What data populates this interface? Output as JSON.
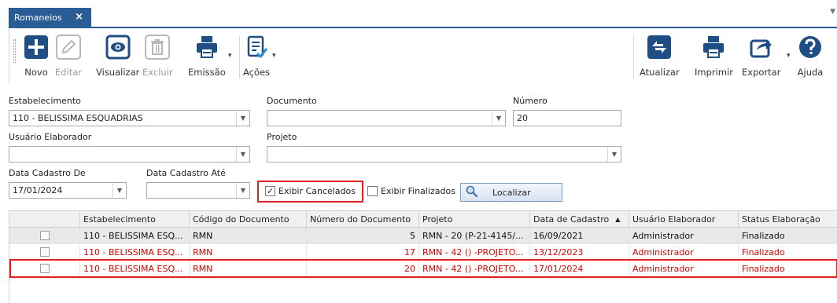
{
  "tab": {
    "label": "Romaneios",
    "close": "×"
  },
  "toolbar": {
    "left": [
      {
        "label": "Novo",
        "icon": "plus-icon",
        "enabled": true
      },
      {
        "label": "Editar",
        "icon": "pencil-icon",
        "enabled": false
      },
      {
        "label": "Visualizar",
        "icon": "eye-icon",
        "enabled": true
      },
      {
        "label": "Excluir",
        "icon": "trash-icon",
        "enabled": false
      },
      {
        "label": "Emissão",
        "icon": "printer-icon",
        "enabled": true
      },
      {
        "label": "Ações",
        "icon": "checklist-icon",
        "enabled": true
      }
    ],
    "right": [
      {
        "label": "Atualizar",
        "icon": "refresh-icon"
      },
      {
        "label": "Imprimir",
        "icon": "printer-icon"
      },
      {
        "label": "Exportar",
        "icon": "export-icon"
      },
      {
        "label": "Ajuda",
        "icon": "help-icon"
      }
    ]
  },
  "filters": {
    "estabelecimento": {
      "label": "Estabelecimento",
      "value": "110 - BELISSIMA ESQUADRIAS"
    },
    "documento": {
      "label": "Documento",
      "value": ""
    },
    "numero": {
      "label": "Número",
      "value": "20"
    },
    "usuario": {
      "label": "Usuário Elaborador",
      "value": ""
    },
    "projeto": {
      "label": "Projeto",
      "value": ""
    },
    "data_de": {
      "label": "Data Cadastro De",
      "value": "17/01/2024"
    },
    "data_ate": {
      "label": "Data Cadastro Até",
      "value": ""
    },
    "exibir_cancelados": {
      "label": "Exibir Cancelados",
      "checked": true
    },
    "exibir_finalizados": {
      "label": "Exibir Finalizados",
      "checked": false
    },
    "localizar": "Localizar"
  },
  "grid": {
    "columns": [
      "Estabelecimento",
      "Código do Documento",
      "Número do Documento",
      "Projeto",
      "Data de Cadastro",
      "Usuário Elaborador",
      "Status Elaboração"
    ],
    "sort_indicator": "▲",
    "rows": [
      {
        "estabelecimento": "110 - BELISSIMA ESQ...",
        "codigo": "RMN",
        "numero": "5",
        "projeto": "RMN - 20 (P-21-4145/...",
        "data": "16/09/2021",
        "usuario": "Administrador",
        "status": "Finalizado",
        "style": "black"
      },
      {
        "estabelecimento": "110 - BELISSIMA ESQ...",
        "codigo": "RMN",
        "numero": "17",
        "projeto": "RMN - 42 () -PROJETO...",
        "data": "13/12/2023",
        "usuario": "Administrador",
        "status": "Finalizado",
        "style": "red"
      },
      {
        "estabelecimento": "110 - BELISSIMA ESQ...",
        "codigo": "RMN",
        "numero": "20",
        "projeto": "RMN - 42 () -PROJETO...",
        "data": "17/01/2024",
        "usuario": "Administrador",
        "status": "Finalizado",
        "style": "red"
      }
    ]
  },
  "colors": {
    "tab_blue": "#2a5d95",
    "icon_blue": "#1f4e84",
    "cancel_red": "#e00000",
    "highlight_red": "#e02020"
  }
}
